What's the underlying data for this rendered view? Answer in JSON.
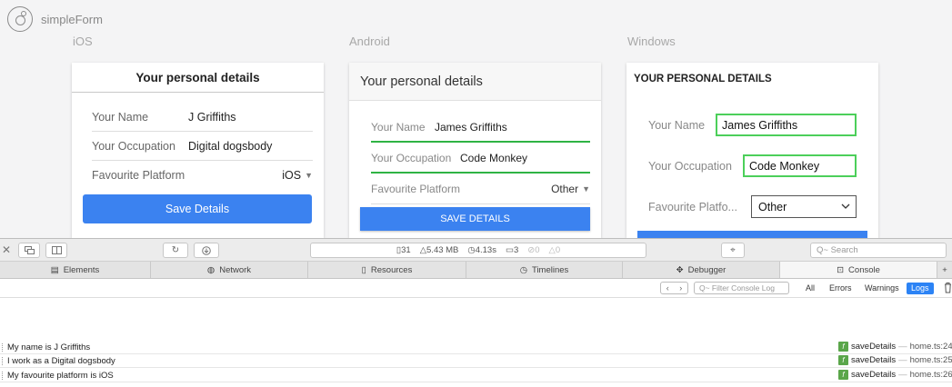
{
  "app": {
    "title": "simpleForm"
  },
  "platforms": {
    "ios": "iOS",
    "android": "Android",
    "windows": "Windows"
  },
  "ios": {
    "title": "Your personal details",
    "name_label": "Your Name",
    "name_value": "J Griffiths",
    "occupation_label": "Your Occupation",
    "occupation_value": "Digital dogsbody",
    "platform_label": "Favourite Platform",
    "platform_value": "iOS",
    "save": "Save Details"
  },
  "android": {
    "title": "Your personal details",
    "name_label": "Your Name",
    "name_value": "James Griffiths",
    "occupation_label": "Your Occupation",
    "occupation_value": "Code Monkey",
    "platform_label": "Favourite Platform",
    "platform_value": "Other",
    "save": "SAVE DETAILS"
  },
  "windows": {
    "title": "YOUR PERSONAL DETAILS",
    "name_label": "Your Name",
    "name_value": "James Griffiths",
    "occupation_label": "Your Occupation",
    "occupation_value": "Code Monkey",
    "platform_label": "Favourite Platfo...",
    "platform_value": "Other"
  },
  "devtools": {
    "activity": {
      "resources": "31",
      "size": "5.43 MB",
      "time": "4.13s",
      "logs": "3",
      "errors": "0",
      "warnings": "0"
    },
    "search_placeholder": "Q~ Search",
    "tabs": [
      "Elements",
      "Network",
      "Resources",
      "Timelines",
      "Debugger",
      "Console"
    ],
    "filter_placeholder": "Q~ Filter Console Log",
    "levels": [
      "All",
      "Errors",
      "Warnings",
      "Logs"
    ],
    "logs": [
      {
        "message": "My name is J Griffiths",
        "func": "saveDetails",
        "location": "home.ts:24"
      },
      {
        "message": "I work as a Digital dogsbody",
        "func": "saveDetails",
        "location": "home.ts:25"
      },
      {
        "message": "My favourite platform is iOS",
        "func": "saveDetails",
        "location": "home.ts:26"
      }
    ],
    "colors": {
      "accent": "#2c83f5",
      "focus_green": "#4ccf5a",
      "button_blue": "#3b82f0"
    }
  }
}
